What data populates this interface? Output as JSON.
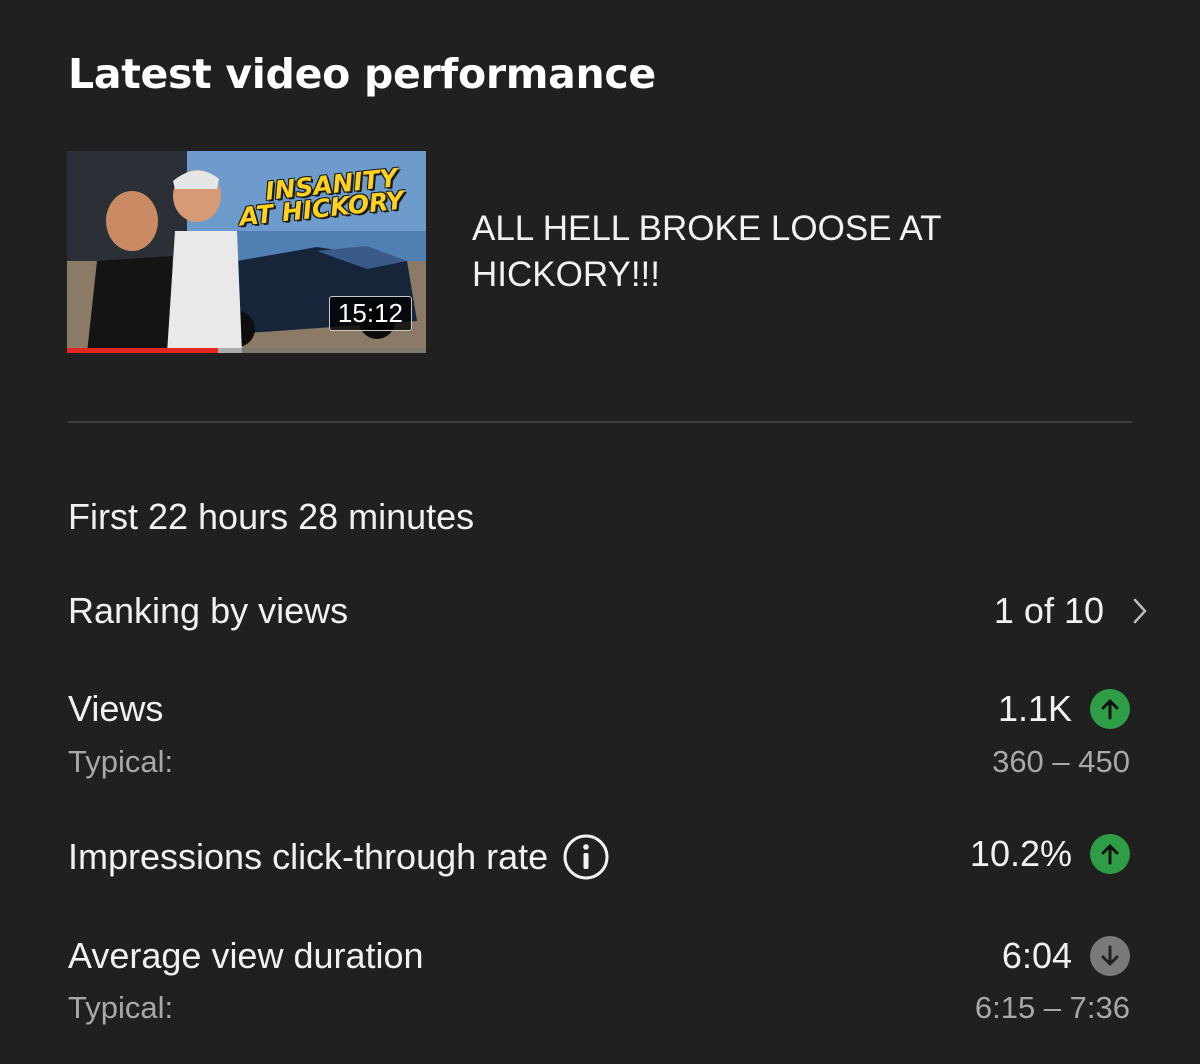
{
  "card": {
    "title": "Latest video performance"
  },
  "video": {
    "title": "ALL HELL BROKE LOOSE AT HICKORY!!!",
    "thumbnail_line1": "INSANITY",
    "thumbnail_line2": "AT HICKORY",
    "duration": "15:12",
    "watched_fraction": 0.42,
    "progress_color": "#e3261f"
  },
  "period": "First 22 hours 28 minutes",
  "metrics": {
    "ranking": {
      "label": "Ranking by views",
      "value": "1 of 10",
      "icon": "chevron-right-icon"
    },
    "views": {
      "label": "Views",
      "value": "1.1K",
      "trend": "up",
      "typical_label": "Typical:",
      "typical_value": "360 – 450"
    },
    "ctr": {
      "label": "Impressions click-through rate",
      "value": "10.2%",
      "trend": "up",
      "info_icon": "info-icon"
    },
    "avd": {
      "label": "Average view duration",
      "value": "6:04",
      "trend": "down",
      "typical_label": "Typical:",
      "typical_value": "6:15 – 7:36"
    }
  },
  "colors": {
    "background": "#202020",
    "trend_up": "#2e9d46",
    "trend_down": "#7a7a7a"
  }
}
